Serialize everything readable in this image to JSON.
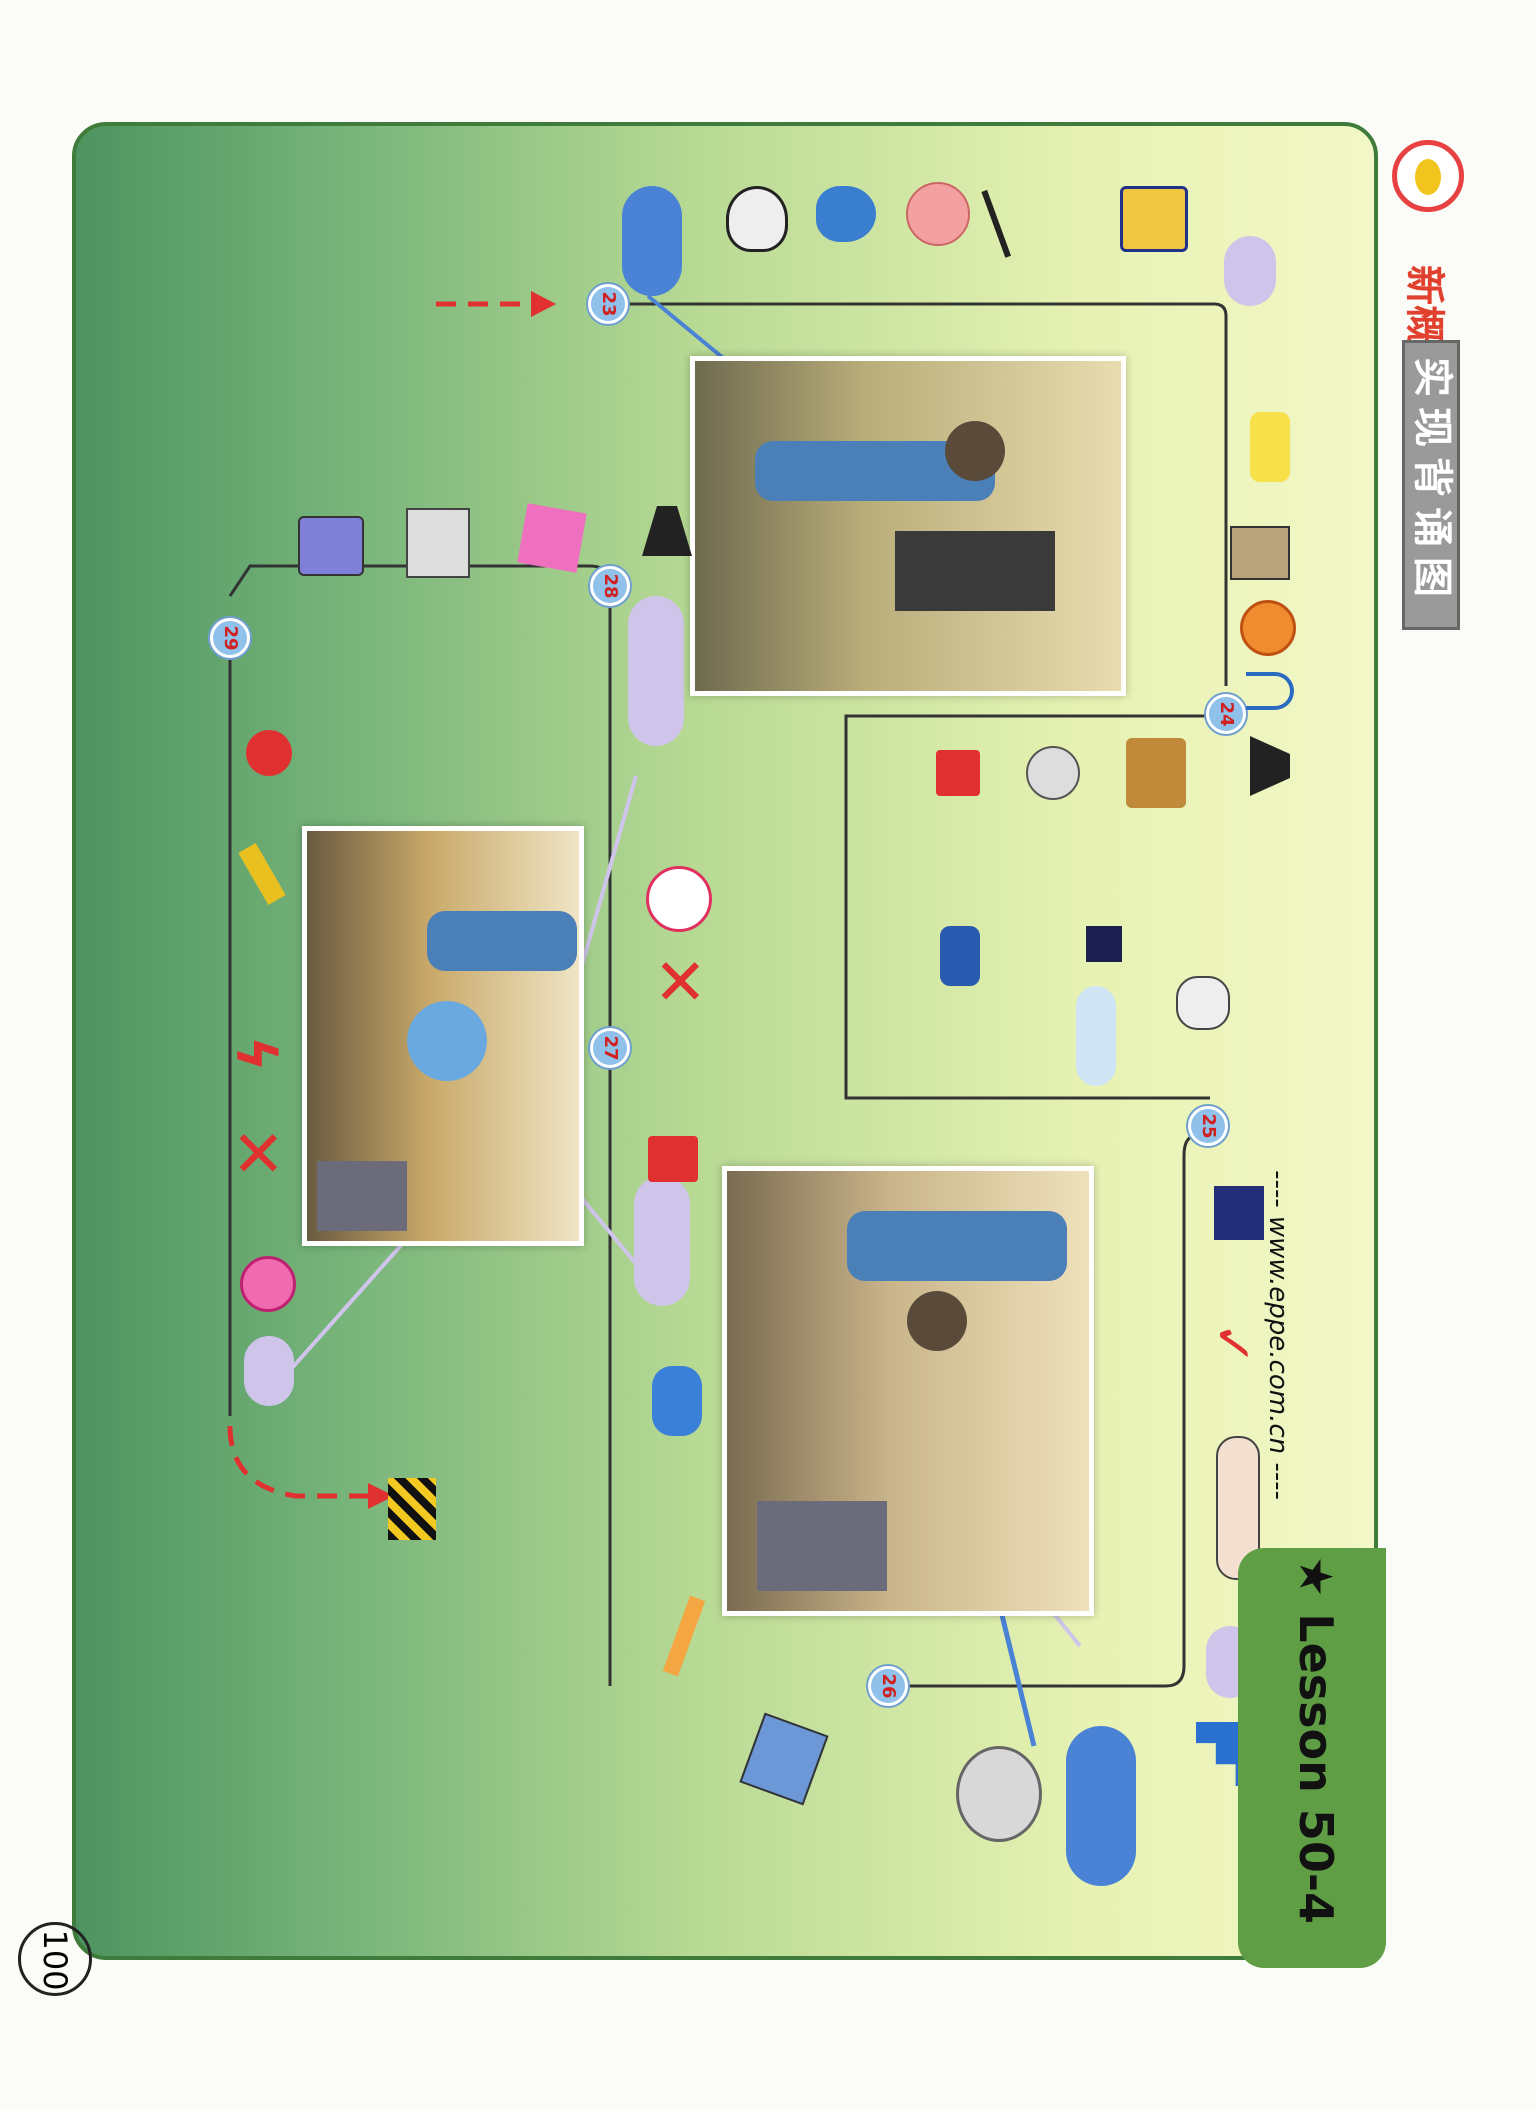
{
  "header": {
    "brand_text": "新概念",
    "title": "实现背诵图",
    "lesson": "★ Lesson 50-4",
    "website": "---- www.eppe.com.cn ----",
    "page_number": "100"
  },
  "steps": [
    "23",
    "24",
    "25",
    "26",
    "27",
    "28",
    "29"
  ],
  "colors": {
    "board_dark": "#4e9460",
    "board_light": "#f3f7c7",
    "tab_green": "#5f9e45",
    "step_badge": "#8fc1ea",
    "red_mark": "#e03030",
    "blue_bubble": "#4a82d6",
    "lilac_bubble": "#cfc4ea"
  },
  "icons": [
    "red-dashed-arrow",
    "money-bag-icon",
    "bottle-icon",
    "pink-face-icon",
    "dancer-icon",
    "cash-register-icon",
    "co2-icon",
    "printer-icon",
    "clock-icon",
    "up-arrow-icon",
    "sitting-person-icon",
    "box-person-icon",
    "sleeping-face-icon",
    "tv-icon",
    "eyes-icon",
    "night-icon",
    "lamp-icon",
    "kneeling-person-icon",
    "city-night-icon",
    "red-check-icon",
    "lips-eye-ear-icon",
    "stairs-icon",
    "mask-icon",
    "mop-icon",
    "cigarette-icon",
    "question-exclaim-icon",
    "car-icon",
    "red-x-icon",
    "singer-icon",
    "form-icon",
    "radio-icon",
    "money-paper-icon",
    "hanging-person-icon",
    "red-question-icon",
    "wrench-icon",
    "red-lightning-icon",
    "pink-clock-icon",
    "hazard-sign-icon"
  ]
}
